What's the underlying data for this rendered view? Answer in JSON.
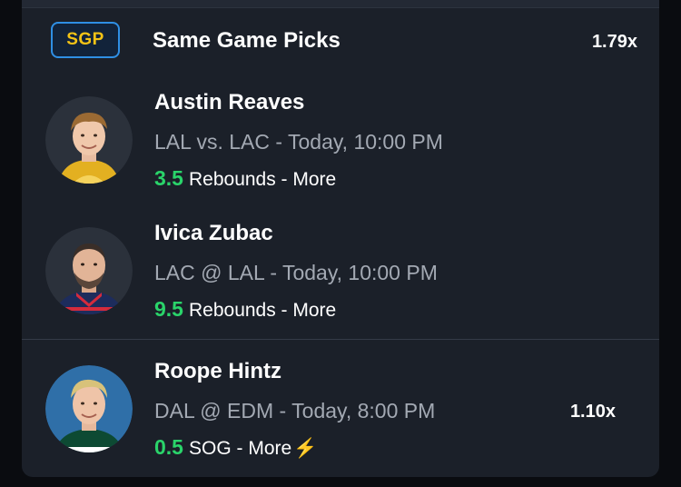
{
  "group": {
    "badge": "SGP",
    "title": "Same Game Picks",
    "multiplier": "1.79x"
  },
  "picks": [
    {
      "player": "Austin Reaves",
      "matchup": "LAL vs. LAC - Today, 10:00 PM",
      "line_value": "3.5",
      "line_text": "Rebounds - More"
    },
    {
      "player": "Ivica Zubac",
      "matchup": "LAC @ LAL - Today, 10:00 PM",
      "line_value": "9.5",
      "line_text": "Rebounds - More"
    },
    {
      "player": "Roope Hintz",
      "matchup": "DAL @ EDM - Today, 8:00 PM",
      "line_value": "0.5",
      "line_text": "SOG - More",
      "multiplier": "1.10x",
      "boost_icon": "lightning-bolt"
    }
  ],
  "colors": {
    "card_bg": "#1b2029",
    "badge_border": "#2f8fe4",
    "badge_text": "#f3c316",
    "line_value": "#2ad46a",
    "matchup_text": "#a3a9b3"
  }
}
